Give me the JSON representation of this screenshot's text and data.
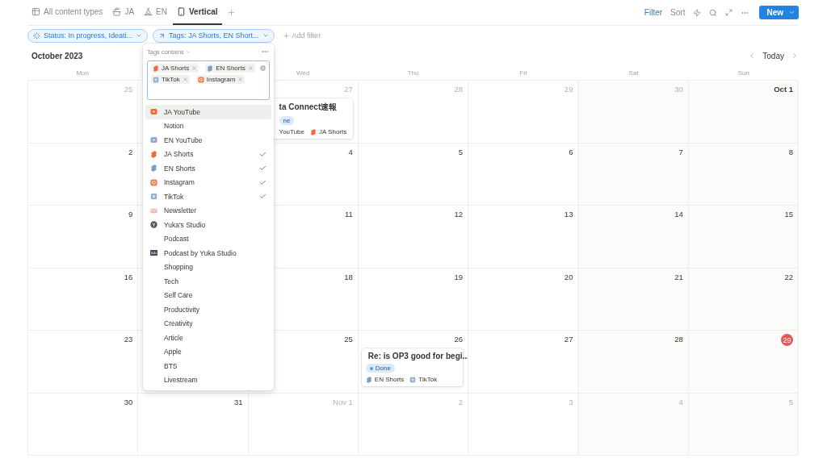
{
  "views": [
    {
      "label": "All content types",
      "kind": "table",
      "selected": false
    },
    {
      "label": "JA",
      "kind": "pot",
      "selected": false
    },
    {
      "label": "EN",
      "kind": "tent",
      "selected": false
    },
    {
      "label": "Vertical",
      "kind": "phone",
      "selected": true
    }
  ],
  "toolbar": {
    "filter": {
      "label": "Filter",
      "active": true
    },
    "sort": {
      "label": "Sort",
      "active": false
    },
    "new_button": "New"
  },
  "filters": [
    {
      "label": "Status: In progress, Ideati...",
      "kind": "spinner"
    },
    {
      "label": "Tags: JA Shorts, EN Short...",
      "kind": "arrow"
    }
  ],
  "add_filter": "Add filter",
  "calendar": {
    "month": "October 2023",
    "today_button": "Today",
    "weekdays": [
      "Mon",
      "Wed",
      "Thu",
      "Fri",
      "Sat",
      "Sun"
    ],
    "weeks": [
      {
        "days": [
          {
            "label": "25",
            "muted": true
          },
          {
            "kind": "covered"
          },
          {
            "label": "27",
            "muted": true,
            "events": [
              {
                "title": "ta Connect速報",
                "status": "ne",
                "tags": [
                  {
                    "label": "YouTube"
                  },
                  {
                    "label": "JA Shorts",
                    "kind": "shorts",
                    "color": "#f06a3b"
                  }
                ]
              }
            ]
          },
          {
            "label": "28",
            "muted": true
          },
          {
            "label": "29",
            "muted": true
          },
          {
            "label": "30",
            "muted": true
          },
          {
            "label": "Oct 1",
            "muted": false,
            "bold": true
          }
        ]
      },
      {
        "days": [
          {
            "label": "2",
            "muted": false
          },
          {
            "kind": "covered"
          },
          {
            "label": "4",
            "muted": false
          },
          {
            "label": "5",
            "muted": false
          },
          {
            "label": "6",
            "muted": false
          },
          {
            "label": "7",
            "muted": false
          },
          {
            "label": "8",
            "muted": false
          }
        ]
      },
      {
        "days": [
          {
            "label": "9",
            "muted": false
          },
          {
            "kind": "covered"
          },
          {
            "label": "11",
            "muted": false
          },
          {
            "label": "12",
            "muted": false
          },
          {
            "label": "13",
            "muted": false
          },
          {
            "label": "14",
            "muted": false
          },
          {
            "label": "15",
            "muted": false
          }
        ]
      },
      {
        "days": [
          {
            "label": "16",
            "muted": false
          },
          {
            "kind": "covered"
          },
          {
            "label": "18",
            "muted": false
          },
          {
            "label": "19",
            "muted": false
          },
          {
            "label": "20",
            "muted": false
          },
          {
            "label": "21",
            "muted": false
          },
          {
            "label": "22",
            "muted": false
          }
        ]
      },
      {
        "days": [
          {
            "label": "23",
            "muted": false
          },
          {
            "kind": "covered"
          },
          {
            "label": "25",
            "muted": false
          },
          {
            "label": "26",
            "muted": false,
            "events": [
              {
                "title": "Re: is OP3 good for begi...",
                "status": "Done",
                "tags": [
                  {
                    "label": "EN Shorts",
                    "kind": "shorts",
                    "color": "#7a9cc6"
                  },
                  {
                    "label": "TikTok",
                    "kind": "square",
                    "color": "#8fa9c9"
                  }
                ]
              }
            ]
          },
          {
            "label": "27",
            "muted": false
          },
          {
            "label": "28",
            "muted": false
          },
          {
            "label": "29",
            "today": true
          }
        ]
      },
      {
        "days": [
          {
            "label": "30",
            "muted": false
          },
          {
            "label": "31",
            "muted": false
          },
          {
            "label": "Nov 1",
            "muted": true
          },
          {
            "label": "2",
            "muted": true
          },
          {
            "label": "3",
            "muted": true
          },
          {
            "label": "4",
            "muted": true
          },
          {
            "label": "5",
            "muted": true
          }
        ]
      }
    ]
  },
  "tag_popover": {
    "condition": "Tags contains",
    "chips": [
      {
        "label": "JA Shorts",
        "kind": "shorts",
        "color": "#f06a3b"
      },
      {
        "label": "EN Shorts",
        "kind": "shorts",
        "color": "#7a9cc6"
      },
      {
        "label": "TikTok",
        "kind": "square",
        "color": "#8fa9c9"
      },
      {
        "label": "Instagram",
        "kind": "camera",
        "color": "#f07b4a"
      }
    ],
    "options": [
      {
        "label": "JA YouTube",
        "kind": "play",
        "color": "#f06a3b",
        "checked": false,
        "highlighted": true
      },
      {
        "label": "Notion",
        "checked": false,
        "highlighted": false
      },
      {
        "label": "EN YouTube",
        "kind": "play",
        "color": "#8fa9c9",
        "checked": false,
        "highlighted": false
      },
      {
        "label": "JA Shorts",
        "kind": "shorts",
        "color": "#f06a3b",
        "checked": true,
        "highlighted": false
      },
      {
        "label": "EN Shorts",
        "kind": "shorts",
        "color": "#7a9cc6",
        "checked": true,
        "highlighted": false
      },
      {
        "label": "Instagram",
        "kind": "camera",
        "color": "#f07b4a",
        "checked": true,
        "highlighted": false
      },
      {
        "label": "TikTok",
        "kind": "square",
        "color": "#8fa9c9",
        "checked": true,
        "highlighted": false
      },
      {
        "label": "Newsletter",
        "kind": "mail",
        "color": "#f2b8a6",
        "checked": false,
        "highlighted": false
      },
      {
        "label": "Yuka's Studio",
        "kind": "logo",
        "color": "#555555",
        "checked": false,
        "highlighted": false
      },
      {
        "label": "Podcast",
        "checked": false,
        "highlighted": false
      },
      {
        "label": "Podcast by Yuka Studio",
        "kind": "podcast",
        "color": "#3a4552",
        "checked": false,
        "highlighted": false
      },
      {
        "label": "Shopping",
        "checked": false,
        "highlighted": false
      },
      {
        "label": "Tech",
        "checked": false,
        "highlighted": false
      },
      {
        "label": "Self Care",
        "checked": false,
        "highlighted": false
      },
      {
        "label": "Productivity",
        "checked": false,
        "highlighted": false
      },
      {
        "label": "Creativity",
        "checked": false,
        "highlighted": false
      },
      {
        "label": "Article",
        "checked": false,
        "highlighted": false
      },
      {
        "label": "Apple",
        "checked": false,
        "highlighted": false
      },
      {
        "label": "BTS",
        "checked": false,
        "highlighted": false
      },
      {
        "label": "Livestream",
        "checked": false,
        "highlighted": false
      }
    ]
  }
}
